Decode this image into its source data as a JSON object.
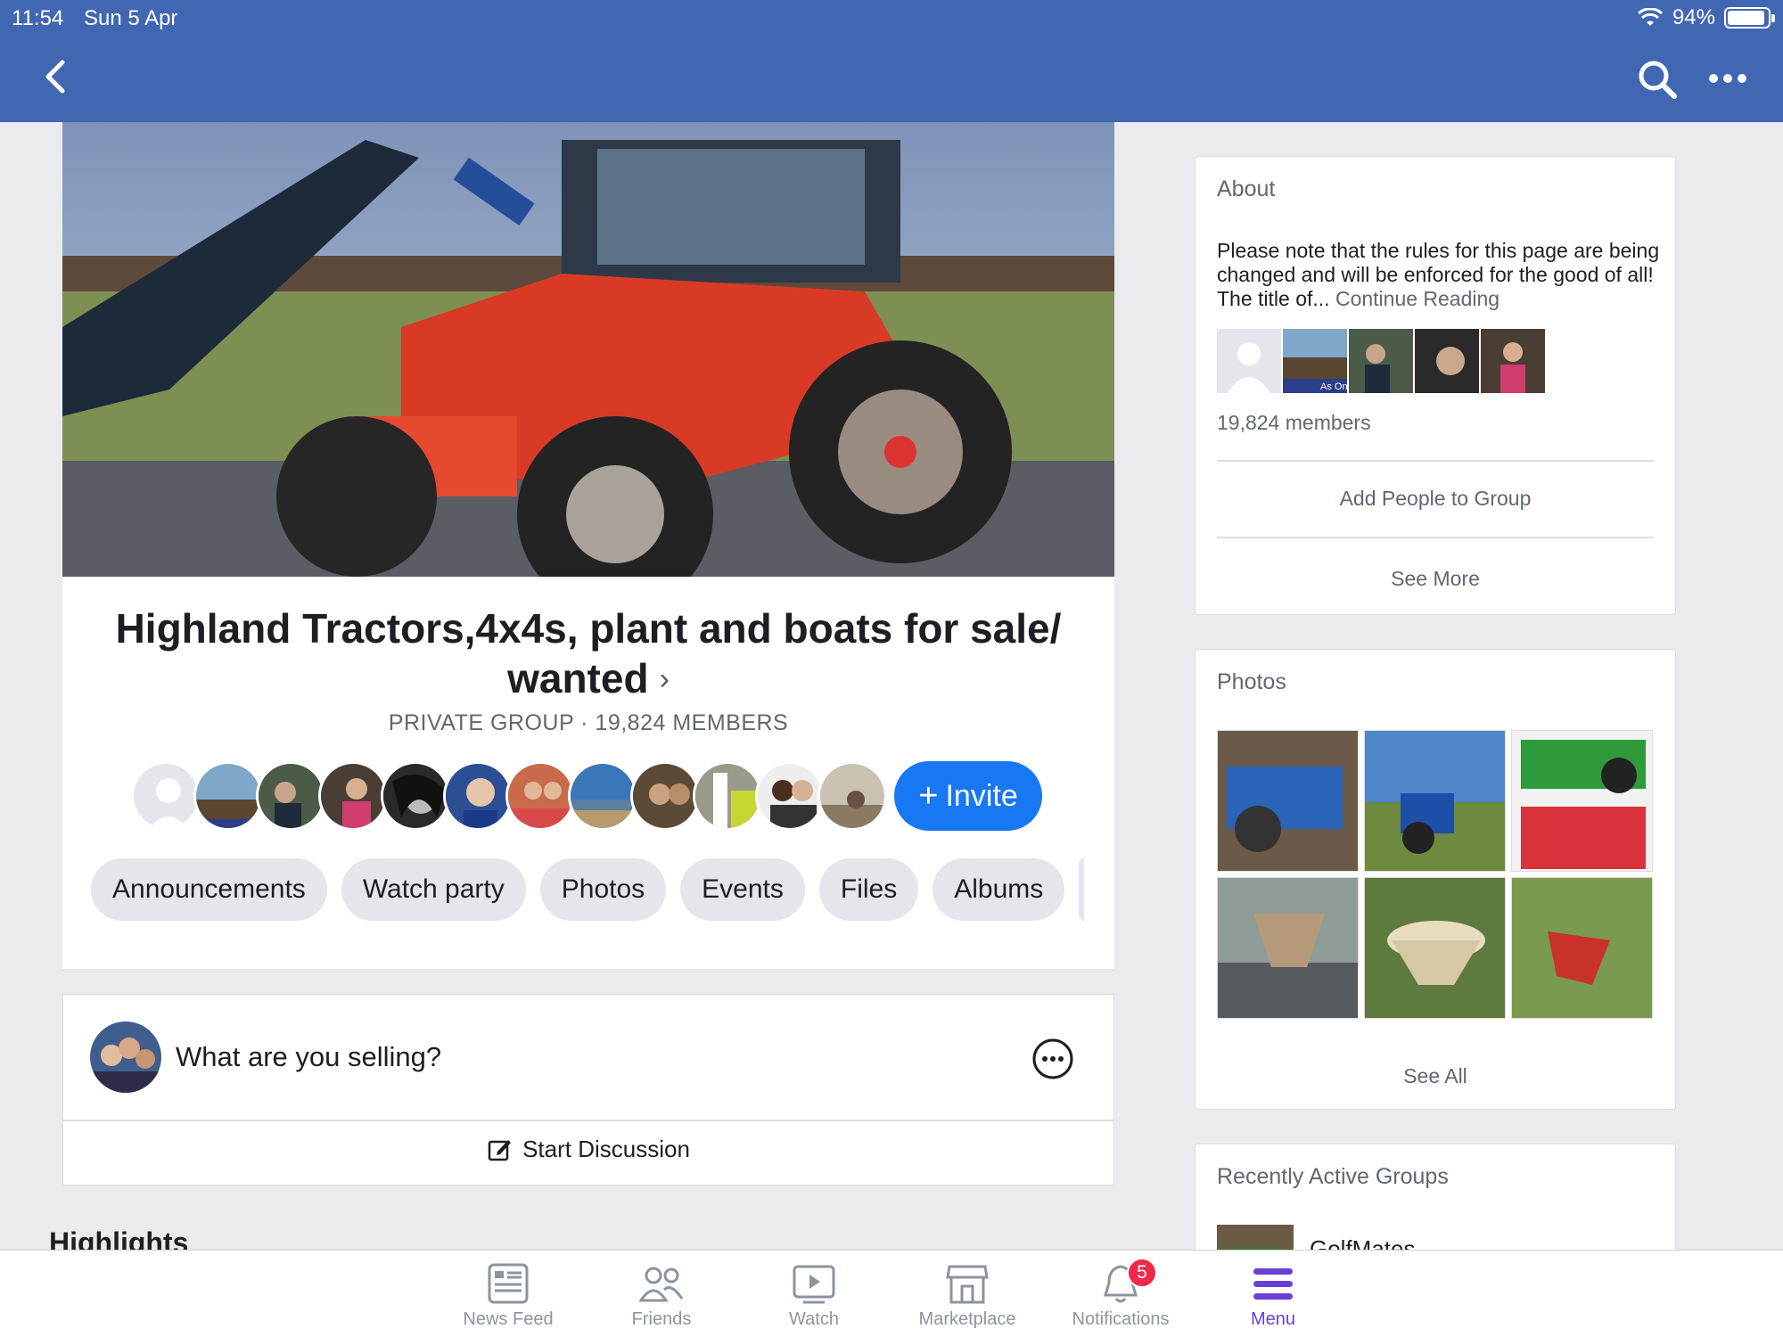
{
  "status_bar": {
    "time": "11:54",
    "date": "Sun 5 Apr",
    "battery": "94%",
    "battery_level": 0.94
  },
  "nav_bar": {
    "back_icon": "chevron-left-icon",
    "search_icon": "search-icon",
    "more_icon": "more-horizontal-icon"
  },
  "group": {
    "title": "Highland Tractors,4x4s, plant and boats for sale/ wanted",
    "meta": "PRIVATE GROUP · 19,824 MEMBERS",
    "invite_label": "Invite",
    "tabs": [
      "Announcements",
      "Watch party",
      "Photos",
      "Events",
      "Files",
      "Albums"
    ]
  },
  "composer": {
    "prompt": "What are you selling?",
    "start_discussion": "Start Discussion"
  },
  "highlights_heading": "Highlights",
  "about": {
    "heading": "About",
    "text": " Please note that the rules for this page are being changed and will be enforced for the good of all! The title of...",
    "continue": "Continue Reading",
    "members": "19,824 members",
    "add_people": "Add People to Group",
    "see_more": "See More",
    "thumb_caption": "As One"
  },
  "photos": {
    "heading": "Photos",
    "see_all": "See All"
  },
  "recent_groups": {
    "heading": "Recently Active Groups",
    "first_group": "GolfMates"
  },
  "bottom_nav": {
    "items": [
      {
        "label": "News Feed",
        "icon": "news-feed-icon"
      },
      {
        "label": "Friends",
        "icon": "friends-icon"
      },
      {
        "label": "Watch",
        "icon": "watch-icon"
      },
      {
        "label": "Marketplace",
        "icon": "marketplace-icon"
      },
      {
        "label": "Notifications",
        "icon": "bell-icon",
        "badge": "5"
      },
      {
        "label": "Menu",
        "icon": "menu-icon",
        "active": true
      }
    ]
  },
  "colors": {
    "brand": "#4267b2",
    "invite": "#1877f2",
    "active_nav": "#6b3fd6",
    "badge": "#f02849"
  }
}
